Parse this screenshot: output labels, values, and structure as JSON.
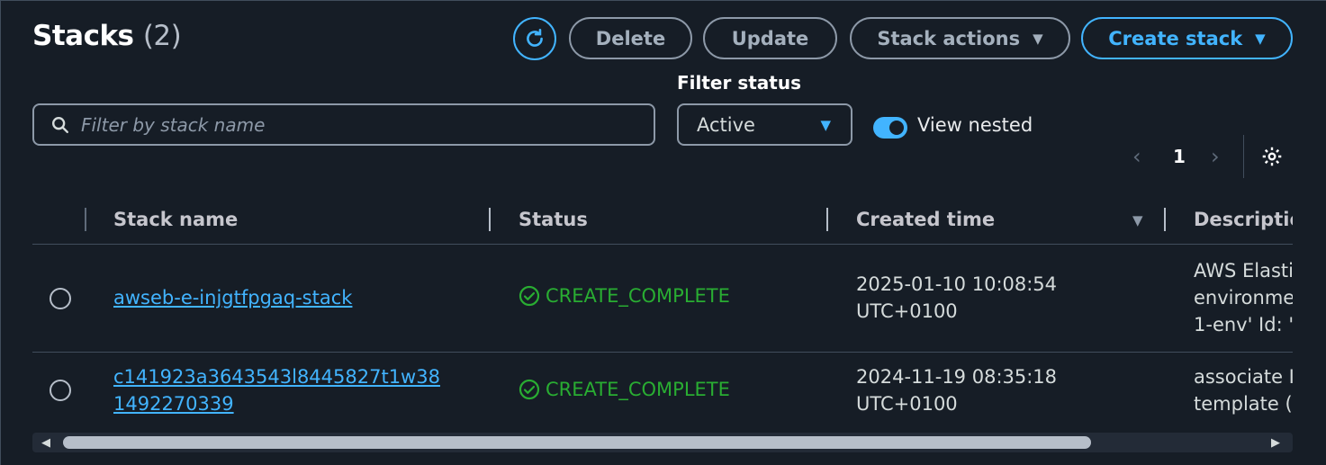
{
  "header": {
    "title": "Stacks",
    "count": "(2)"
  },
  "toolbar": {
    "refresh_icon": "refresh-icon",
    "delete_label": "Delete",
    "update_label": "Update",
    "stack_actions_label": "Stack actions",
    "create_stack_label": "Create stack"
  },
  "filters": {
    "search_placeholder": "Filter by stack name",
    "status_label": "Filter status",
    "status_value": "Active",
    "view_nested_label": "View nested",
    "view_nested_on": true
  },
  "pagination": {
    "current_page": "1",
    "prev_icon": "chevron-left-icon",
    "next_icon": "chevron-right-icon",
    "settings_icon": "gear-icon"
  },
  "table": {
    "columns": [
      "Stack name",
      "Status",
      "Created time",
      "Description"
    ],
    "rows": [
      {
        "name": "awseb-e-injgtfpgaq-stack",
        "status": "CREATE_COMPLETE",
        "created_line1": "2025-01-10 10:08:54",
        "created_line2": "UTC+0100",
        "desc_line1": "AWS Elastic",
        "desc_line2": "environment",
        "desc_line3": "1-env' Id: '"
      },
      {
        "name_line1": "c141923a3643543l8445827t1w38",
        "name_line2": "1492270339",
        "status": "CREATE_COMPLETE",
        "created_line1": "2024-11-19 08:35:18",
        "created_line2": "UTC+0100",
        "desc_line1": "associate IP",
        "desc_line2": "template ("
      }
    ]
  },
  "colors": {
    "background": "#161d26",
    "accent": "#42b4ff",
    "success": "#29ad32"
  }
}
